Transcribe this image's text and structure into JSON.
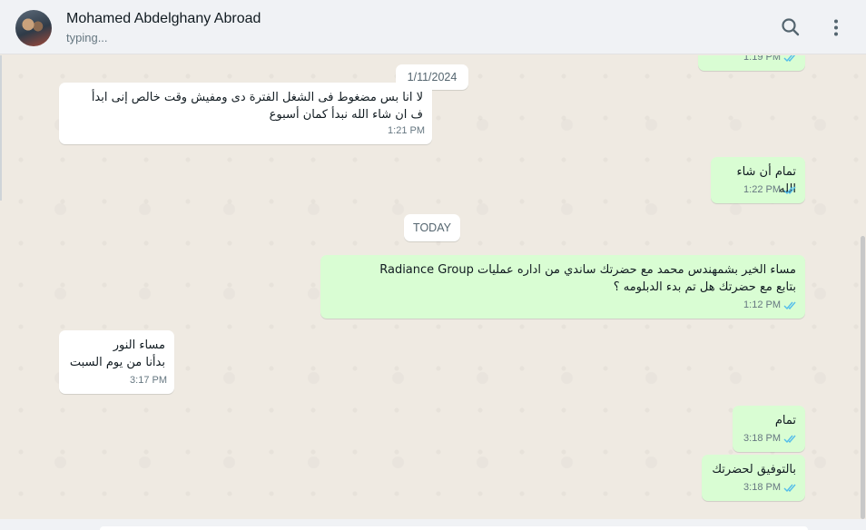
{
  "header": {
    "contact_name": "Mohamed Abdelghany Abroad",
    "status": "typing...",
    "icons": {
      "search": "search-icon",
      "menu": "more-vertical-icon"
    }
  },
  "colors": {
    "incoming": "#ffffff",
    "outgoing": "#d9fdd3",
    "tick_read": "#53bdeb"
  },
  "messages": [
    {
      "direction": "out",
      "text": "",
      "time": "1:19 PM",
      "read": true
    },
    {
      "type": "date",
      "text": "1/11/2024"
    },
    {
      "direction": "in",
      "text": "لا انا بس مضغوط فى الشغل الفترة دى ومفيش وقت خالص إنى ابدأ\nف ان شاء الله نبدأ كمان أسبوع",
      "time": "1:21 PM"
    },
    {
      "direction": "out",
      "text": "تمام أن شاء الله",
      "time": "1:22 PM",
      "read": true
    },
    {
      "type": "date",
      "text": "TODAY"
    },
    {
      "direction": "out",
      "text": "مساء الخير بشمهندس محمد مع حضرتك ساندي من اداره عمليات Radiance Group\nبتابع مع حضرتك هل تم بدء الدبلومه ؟",
      "time": "1:12 PM",
      "read": true
    },
    {
      "direction": "in",
      "text": "مساء النور\nبدأنا من يوم السبت",
      "time": "3:17 PM"
    },
    {
      "direction": "out",
      "text": "تمام",
      "time": "3:18 PM",
      "read": true
    },
    {
      "direction": "out",
      "text": "بالتوفيق لحضرتك",
      "time": "3:18 PM",
      "read": true
    }
  ]
}
